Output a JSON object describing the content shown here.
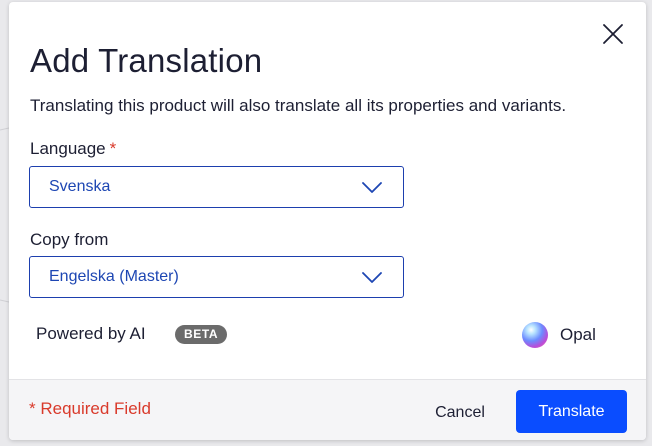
{
  "dialog": {
    "title": "Add Translation",
    "description": "Translating this product will also translate all its properties and variants.",
    "close_icon": "close-icon"
  },
  "language_field": {
    "label": "Language",
    "required_marker": "*",
    "value": "Svenska",
    "icon": "chevron-down-icon"
  },
  "copy_from_field": {
    "label": "Copy from",
    "value": "Engelska (Master)",
    "icon": "chevron-down-icon"
  },
  "ai": {
    "powered_label": "Powered by AI",
    "badge": "BETA",
    "brand_name": "Opal",
    "brand_icon": "opal-logo-icon"
  },
  "footer": {
    "required_note": "* Required Field",
    "cancel_label": "Cancel",
    "translate_label": "Translate"
  },
  "colors": {
    "primary": "#0a4dff",
    "field_border": "#1d3fae",
    "field_text": "#1d46b3",
    "required": "#d93a2b",
    "badge_bg": "#6b6b6b"
  }
}
